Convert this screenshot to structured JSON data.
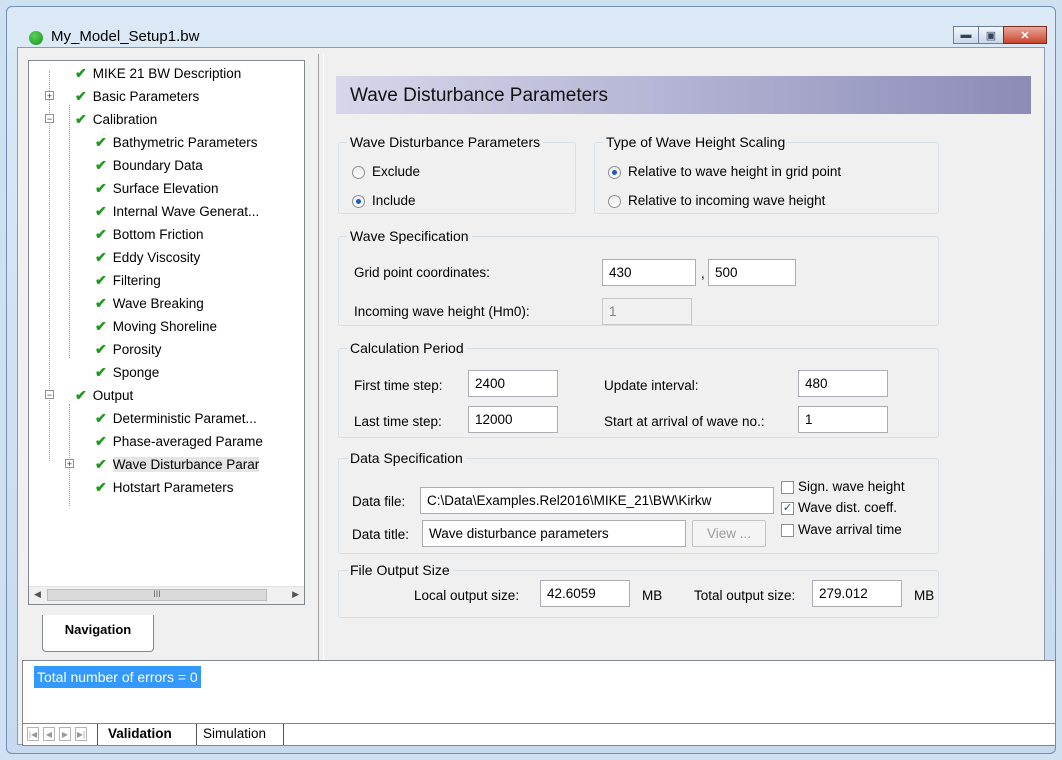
{
  "window": {
    "title": "My_Model_Setup1.bw",
    "controls": {
      "minimize": "▬",
      "maximize": "▣",
      "close": "✕"
    }
  },
  "navigation": {
    "tab_label": "Navigation",
    "scroll_thumb": "III",
    "items": [
      {
        "label": "MIKE 21 BW Description",
        "expander": ""
      },
      {
        "label": "Basic Parameters",
        "expander": "+"
      },
      {
        "label": "Calibration",
        "expander": "−"
      },
      {
        "label": "Bathymetric Parameters",
        "expander": ""
      },
      {
        "label": "Boundary Data",
        "expander": ""
      },
      {
        "label": "Surface Elevation",
        "expander": ""
      },
      {
        "label": "Internal Wave Generat...",
        "expander": ""
      },
      {
        "label": "Bottom Friction",
        "expander": ""
      },
      {
        "label": "Eddy Viscosity",
        "expander": ""
      },
      {
        "label": "Filtering",
        "expander": ""
      },
      {
        "label": "Wave Breaking",
        "expander": ""
      },
      {
        "label": "Moving Shoreline",
        "expander": ""
      },
      {
        "label": "Porosity",
        "expander": ""
      },
      {
        "label": "Sponge",
        "expander": ""
      },
      {
        "label": "Output",
        "expander": "−"
      },
      {
        "label": "Deterministic Paramet...",
        "expander": ""
      },
      {
        "label": "Phase-averaged Parame",
        "expander": ""
      },
      {
        "label": "Wave Disturbance Parar",
        "expander": "+"
      },
      {
        "label": "Hotstart Parameters",
        "expander": ""
      }
    ]
  },
  "panel": {
    "header": "Wave Disturbance Parameters",
    "wdp": {
      "legend": "Wave Disturbance Parameters",
      "exclude": "Exclude",
      "include": "Include"
    },
    "scaling": {
      "legend": "Type of Wave Height Scaling",
      "grid_point": "Relative to wave height in grid point",
      "incoming": "Relative to incoming wave height"
    },
    "spec": {
      "legend": "Wave Specification",
      "grid_label": "Grid point coordinates:",
      "grid_x": "430",
      "separator": ",",
      "grid_y": "500",
      "hm0_label": "Incoming wave height (Hm0):",
      "hm0": "1"
    },
    "period": {
      "legend": "Calculation Period",
      "first_label": "First time step:",
      "first": "2400",
      "last_label": "Last time step:",
      "last": "12000",
      "update_label": "Update interval:",
      "update": "480",
      "arrival_label": "Start at arrival of wave no.:",
      "arrival": "1"
    },
    "data": {
      "legend": "Data Specification",
      "file_label": "Data file:",
      "file": "C:\\Data\\Examples.Rel2016\\MIKE_21\\BW\\Kirkw",
      "title_label": "Data title:",
      "title": "Wave disturbance parameters",
      "view": "View ...",
      "sign_wave": "Sign. wave height",
      "dist_coeff": "Wave dist. coeff.",
      "arrival_time": "Wave arrival time",
      "check_mark": "✓"
    },
    "output": {
      "legend": "File Output Size",
      "local_label": "Local output size:",
      "local": "42.6059",
      "local_unit": "MB",
      "total_label": "Total output size:",
      "total": "279.012",
      "total_unit": "MB"
    }
  },
  "validation": {
    "message": "Total number of errors = 0",
    "tabs": [
      "Validation",
      "Simulation"
    ]
  }
}
